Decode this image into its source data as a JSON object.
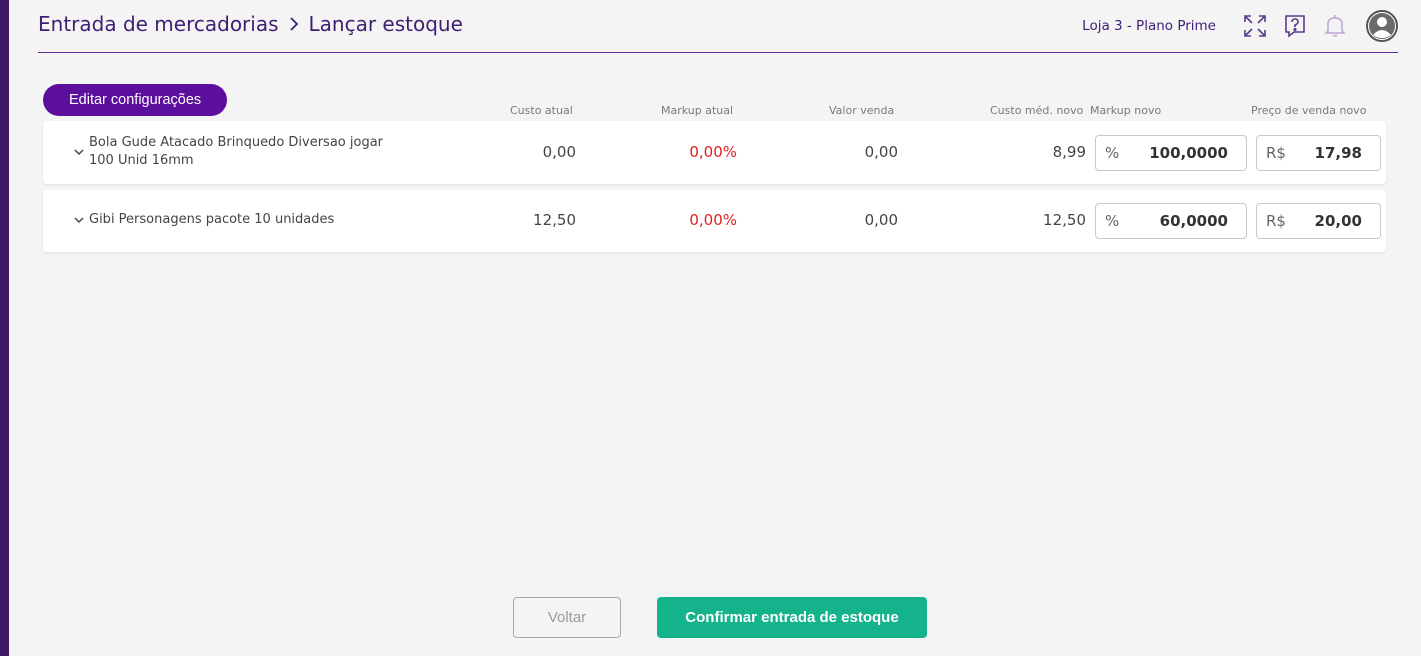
{
  "header": {
    "breadcrumb_parent": "Entrada de mercadorias",
    "breadcrumb_current": "Lançar estoque",
    "store_label": "Loja 3 - Plano Prime",
    "icons": [
      "expand-icon",
      "help-chat-icon",
      "bell-icon",
      "user-avatar-icon"
    ]
  },
  "toolbar": {
    "edit_label": "Editar configurações"
  },
  "columns": {
    "custo_atual": "Custo atual",
    "markup_atual": "Markup atual",
    "valor_venda": "Valor venda",
    "custo_med_novo": "Custo méd. novo",
    "markup_novo": "Markup novo",
    "preco_venda_novo": "Preço de venda novo"
  },
  "products": [
    {
      "name_line1": "Bola Gude Atacado Brinquedo Diversao jogar",
      "name_line2": "100 Unid 16mm",
      "custo_atual": "0,00",
      "markup_atual": "0,00%",
      "valor_venda": "0,00",
      "custo_med_novo": "8,99",
      "markup_prefix": "%",
      "markup_novo": "100,0000",
      "preco_prefix": "R$",
      "preco_venda_novo": "17,98"
    },
    {
      "name_line1": "Gibi Personagens pacote 10 unidades",
      "name_line2": "",
      "custo_atual": "12,50",
      "markup_atual": "0,00%",
      "valor_venda": "0,00",
      "custo_med_novo": "12,50",
      "markup_prefix": "%",
      "markup_novo": "60,0000",
      "preco_prefix": "R$",
      "preco_venda_novo": "20,00"
    }
  ],
  "footer": {
    "back_label": "Voltar",
    "confirm_label": "Confirmar entrada de estoque"
  },
  "colors": {
    "brand_purple": "#5b0f9c",
    "header_text": "#3e1f73",
    "confirm_green": "#14b38c",
    "negative_red": "#e01f1f"
  }
}
